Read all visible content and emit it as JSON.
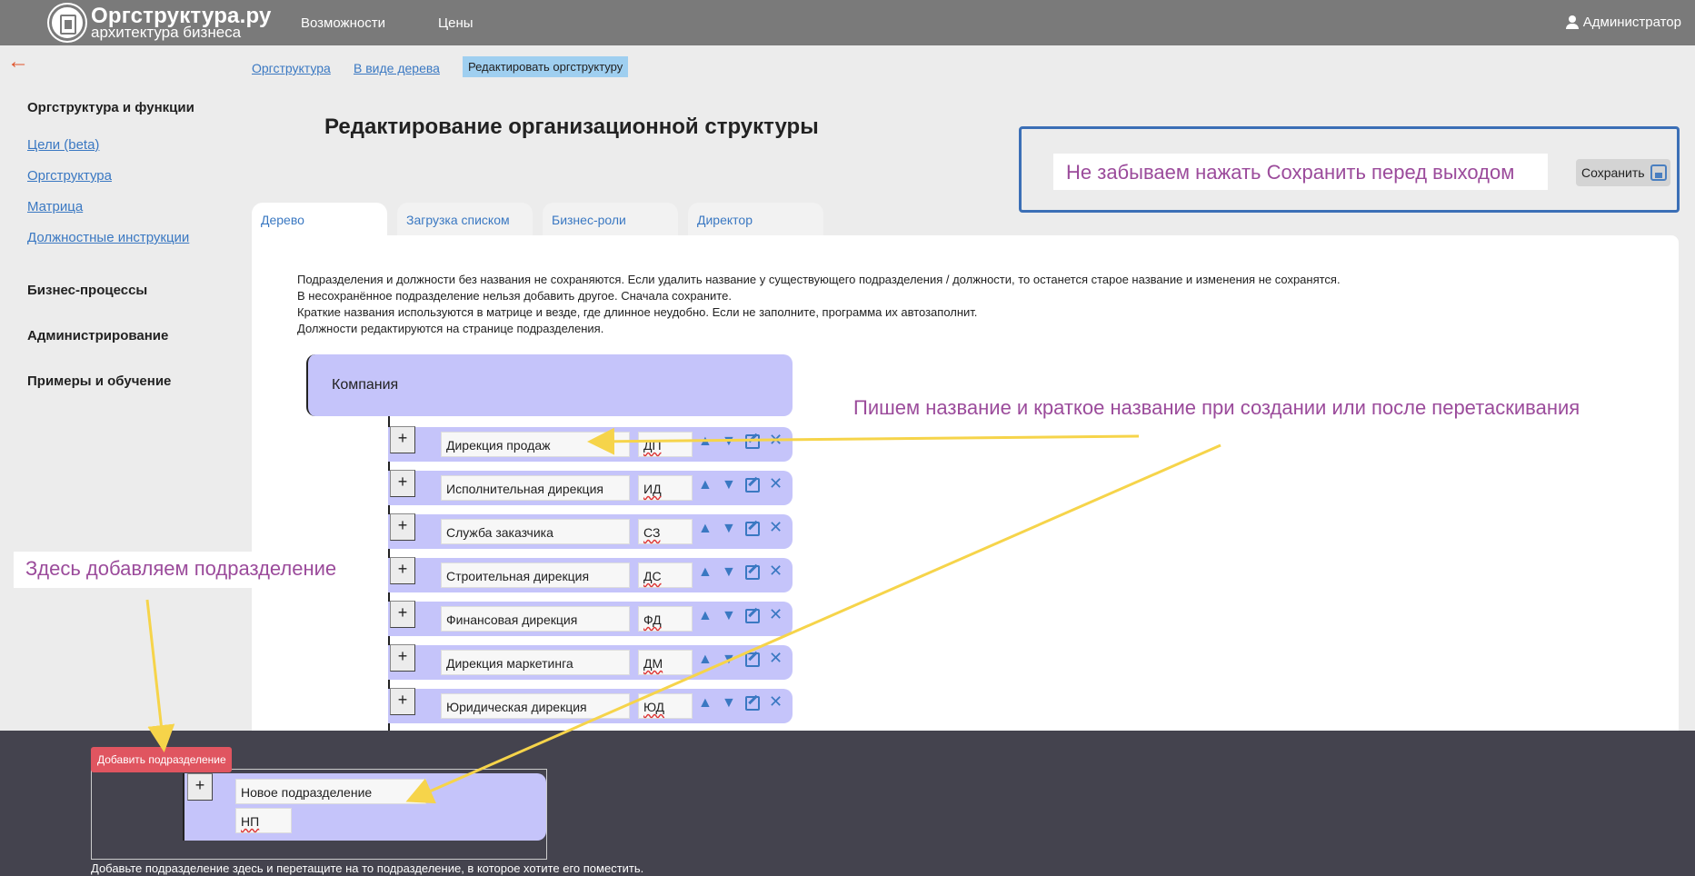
{
  "header": {
    "logo_title": "Оргструктура.ру",
    "logo_sub": "архитектура бизнеса",
    "nav": [
      "Возможности",
      "Цены"
    ],
    "user": "Администратор"
  },
  "back": "←",
  "breadcrumb": {
    "items": [
      "Оргструктура",
      "В виде дерева"
    ],
    "active": "Редактировать оргструктуру"
  },
  "sidebar": {
    "section1": "Оргструктура и функции",
    "links": [
      "Цели (beta)",
      "Оргструктура",
      "Матрица",
      "Должностные инструкции"
    ],
    "section2": "Бизнес-процессы",
    "section3": "Администрирование",
    "section4": "Примеры и обучение"
  },
  "page_title": "Редактирование организационной структуры",
  "save": {
    "note": "Не забываем нажать  Сохранить перед выходом",
    "button": "Сохранить"
  },
  "tabs": [
    "Дерево",
    "Загрузка списком",
    "Бизнес-роли",
    "Директор"
  ],
  "info": [
    "Подразделения и должности без названия не сохраняются. Если удалить название у существующего подразделения / должности, то останется старое название и изменения не сохранятся.",
    "В несохранённое подразделение нельзя добавить другое. Сначала сохраните.",
    "Краткие названия используются в матрице и везде, где длинное неудобно. Если не заполните, программа их автозаполнит.",
    "Должности редактируются на странице подразделения."
  ],
  "tree": {
    "root": "Компания",
    "plus": "+",
    "rows": [
      {
        "name": "Дирекция продаж",
        "short": "ДП"
      },
      {
        "name": "Исполнительная дирекция",
        "short": "ИД"
      },
      {
        "name": "Служба заказчика",
        "short": "СЗ"
      },
      {
        "name": "Строительная дирекция",
        "short": "ДС"
      },
      {
        "name": "Финансовая дирекция",
        "short": "ФД"
      },
      {
        "name": "Дирекция маркетинга",
        "short": "ДМ"
      },
      {
        "name": "Юридическая дирекция",
        "short": "ЮД"
      }
    ],
    "icons": {
      "up": "▲",
      "down": "▼",
      "del": "✕"
    }
  },
  "annotations": {
    "right": "Пишем название и краткое название при создании или после перетаскивания",
    "left": "Здесь добавляем подразделение"
  },
  "dock": {
    "add_button": "Добавить подразделение",
    "new_name": "Новое подразделение",
    "new_short": "НП",
    "hint": "Добавьте подразделение здесь и перетащите на то подразделение, в которое хотите его поместить."
  },
  "colors": {
    "topbar": "#7a7a7a",
    "node": "#c5c4fa",
    "link": "#3a78c2",
    "annotation": "#9b4b9b",
    "arrow": "#f6d44a",
    "add_button": "#e05560",
    "dock": "#44434e"
  }
}
